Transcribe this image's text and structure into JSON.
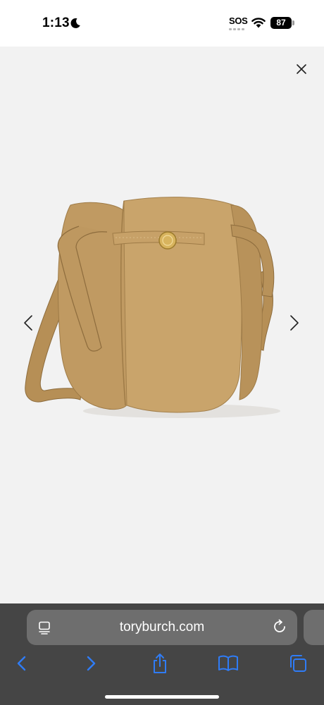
{
  "status_bar": {
    "time": "1:13",
    "moon_icon": "moon-icon",
    "sos_label": "SOS",
    "wifi_icon": "wifi-icon",
    "battery_level": "87"
  },
  "viewer": {
    "close_icon": "close-icon",
    "prev_icon": "chevron-left-icon",
    "next_icon": "chevron-right-icon",
    "product_image": "tan-leather-bucket-bag"
  },
  "browser": {
    "url": "toryburch.com",
    "page_menu_icon": "page-menu-icon",
    "reload_icon": "reload-icon",
    "toolbar": {
      "back_icon": "back-icon",
      "forward_icon": "forward-icon",
      "share_icon": "share-icon",
      "bookmarks_icon": "bookmarks-icon",
      "tabs_icon": "tabs-icon"
    }
  },
  "colors": {
    "accent": "#2f7cf6",
    "toolbar_bg": "#454545",
    "url_field_bg": "#6e6e6e",
    "viewer_bg": "#f2f2f2"
  }
}
